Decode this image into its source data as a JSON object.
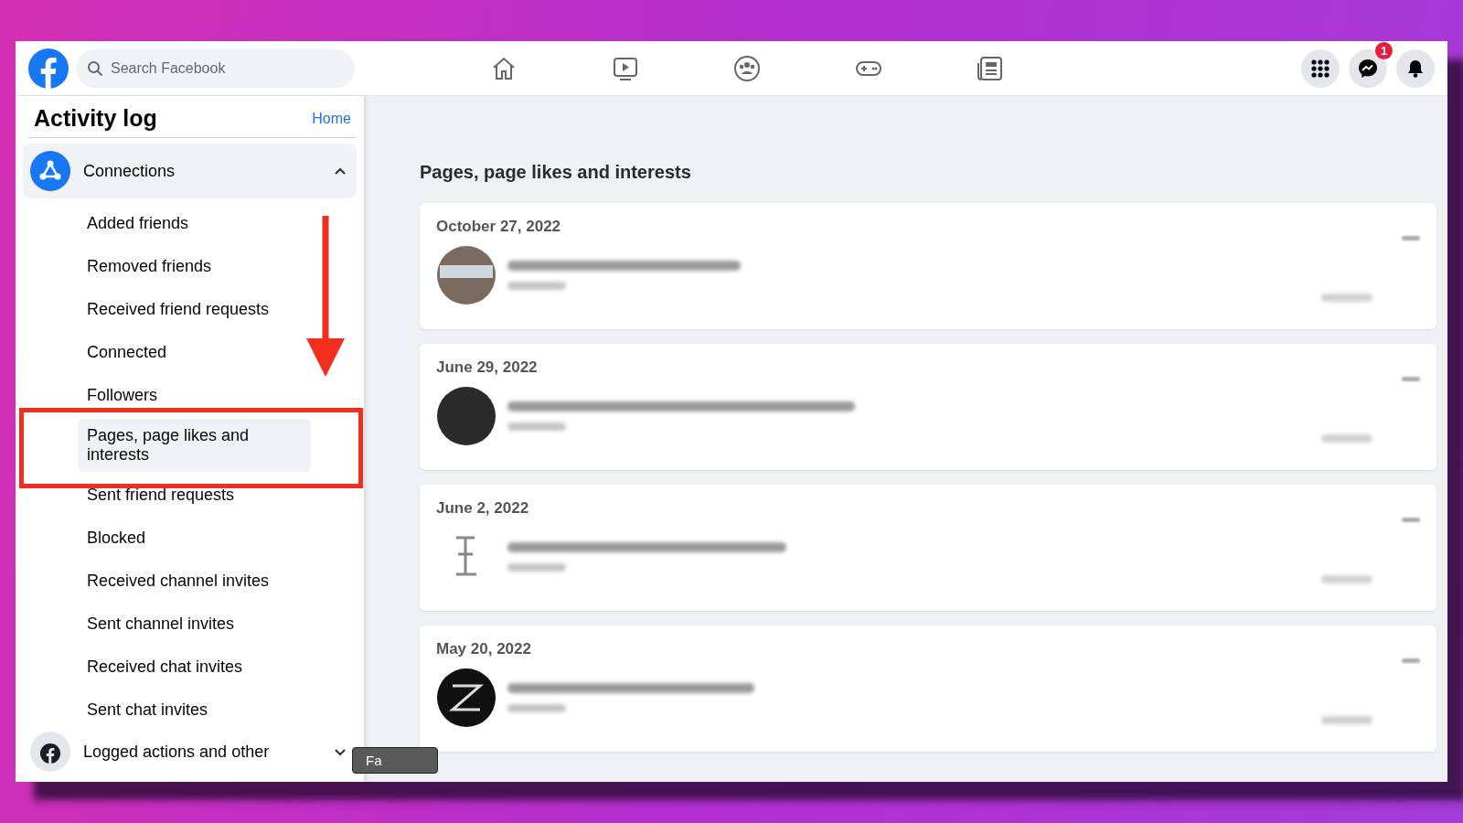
{
  "topbar": {
    "search": {
      "placeholder": "Search Facebook"
    },
    "messenger_badge": "1"
  },
  "sidebar": {
    "title": "Activity log",
    "home_link": "Home",
    "section": {
      "label": "Connections",
      "expanded": true,
      "items": [
        {
          "label": "Added friends",
          "selected": false
        },
        {
          "label": "Removed friends",
          "selected": false
        },
        {
          "label": "Received friend requests",
          "selected": false
        },
        {
          "label": "Connected",
          "selected": false
        },
        {
          "label": "Followers",
          "selected": false
        },
        {
          "label": "Pages, page likes and interests",
          "selected": true
        },
        {
          "label": "Sent friend requests",
          "selected": false
        },
        {
          "label": "Blocked",
          "selected": false
        },
        {
          "label": "Received channel invites",
          "selected": false
        },
        {
          "label": "Sent channel invites",
          "selected": false
        },
        {
          "label": "Received chat invites",
          "selected": false
        },
        {
          "label": "Sent chat invites",
          "selected": false
        }
      ]
    },
    "footer_section": {
      "label": "Logged actions and other",
      "expanded": false
    }
  },
  "main": {
    "heading": "Pages, page likes and interests",
    "entries": [
      {
        "date": "October 27, 2022",
        "kind": "photo"
      },
      {
        "date": "June 29, 2022",
        "kind": "dark"
      },
      {
        "date": "June 2, 2022",
        "kind": "sketch"
      },
      {
        "date": "May 20, 2022",
        "kind": "monogram"
      }
    ]
  },
  "tooltip": {
    "label": "Fa"
  }
}
